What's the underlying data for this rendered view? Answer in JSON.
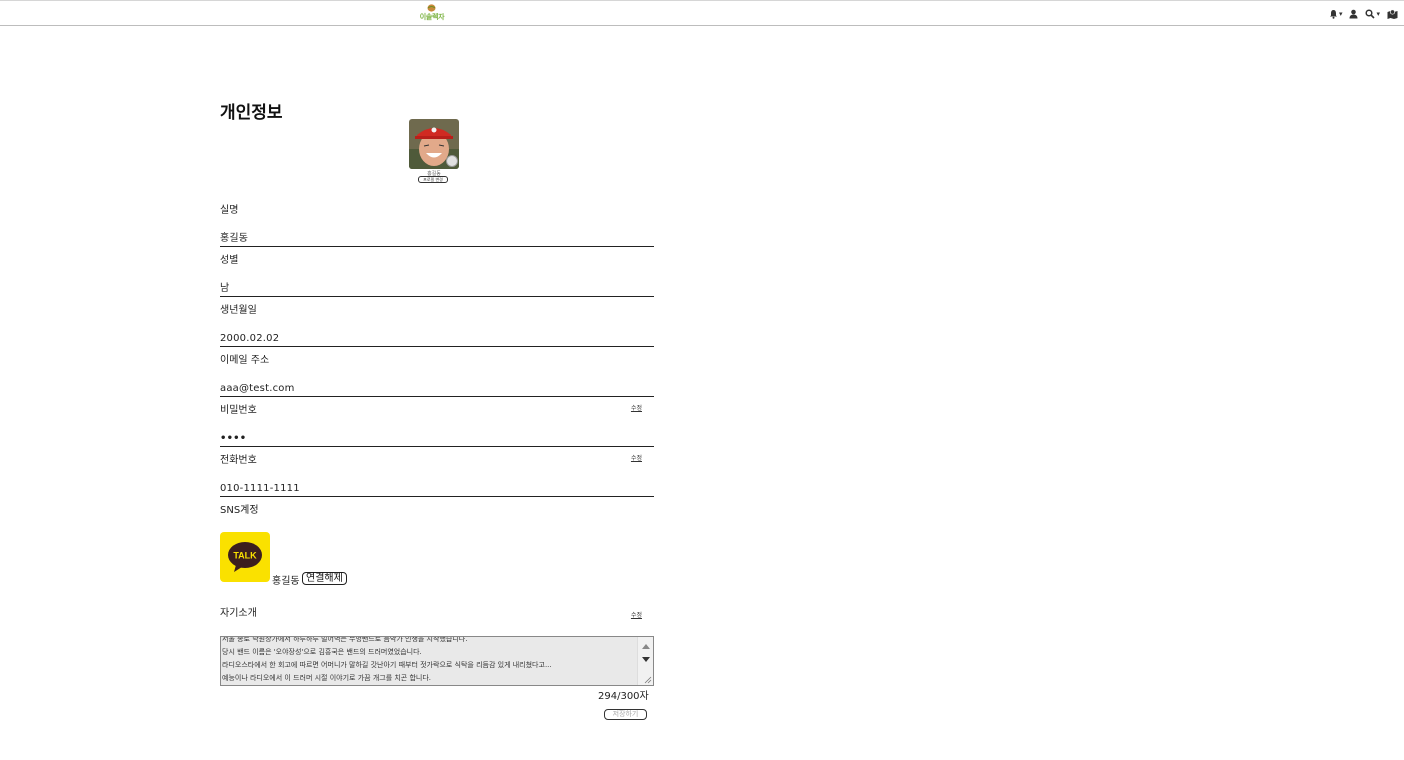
{
  "header": {
    "logo_text": "이솔렉자",
    "icons": [
      "bell-icon",
      "user-icon",
      "search-icon",
      "map-icon"
    ],
    "caret": "▾"
  },
  "page": {
    "title": "개인정보"
  },
  "profile": {
    "name_caption": "홍길동",
    "photo_button_label": "프로필 변경"
  },
  "fields": {
    "name": {
      "label": "실명",
      "value": "홍길동"
    },
    "gender": {
      "label": "성별",
      "value": "남"
    },
    "birth": {
      "label": "생년월일",
      "value": "2000.02.02"
    },
    "email": {
      "label": "이메일 주소",
      "value": "aaa@test.com"
    },
    "password": {
      "label": "비밀번호",
      "value": "••••",
      "edit_label": "수정"
    },
    "phone": {
      "label": "전화번호",
      "value": "010-1111-1111",
      "edit_label": "수정"
    }
  },
  "sns": {
    "label": "SNS계정",
    "kakao_icon_text": "TALK",
    "account_name": "홍길동",
    "unlink_label": "연결해제",
    "kakao_color": "#fae100"
  },
  "intro": {
    "label": "자기소개",
    "edit_label": "수정",
    "lines": [
      "서울 종로 낙원상가에서 하루하루 벌어먹는 무명밴드로 음악가 인생을 시작했습니다.",
      "당시 밴드 이름은 '오야장성'으로 김흥국은 밴드의 드러머였었습니다.",
      "라디오스타에서 한 회고에 따르면 어머니가 말하길 갓난아기 때부터 젓가락으로 식탁을 리듬감 있게 내리쳤다고...",
      "예능이나 라디오에서 이 드러머 시절 이야기로 가끔 개그를 치곤 합니다."
    ],
    "counter": "294/300자",
    "save_label": "저장하기"
  },
  "colors": {
    "accent_green": "#7cb342",
    "text": "#222222",
    "textarea_bg": "#e9e9e9"
  }
}
